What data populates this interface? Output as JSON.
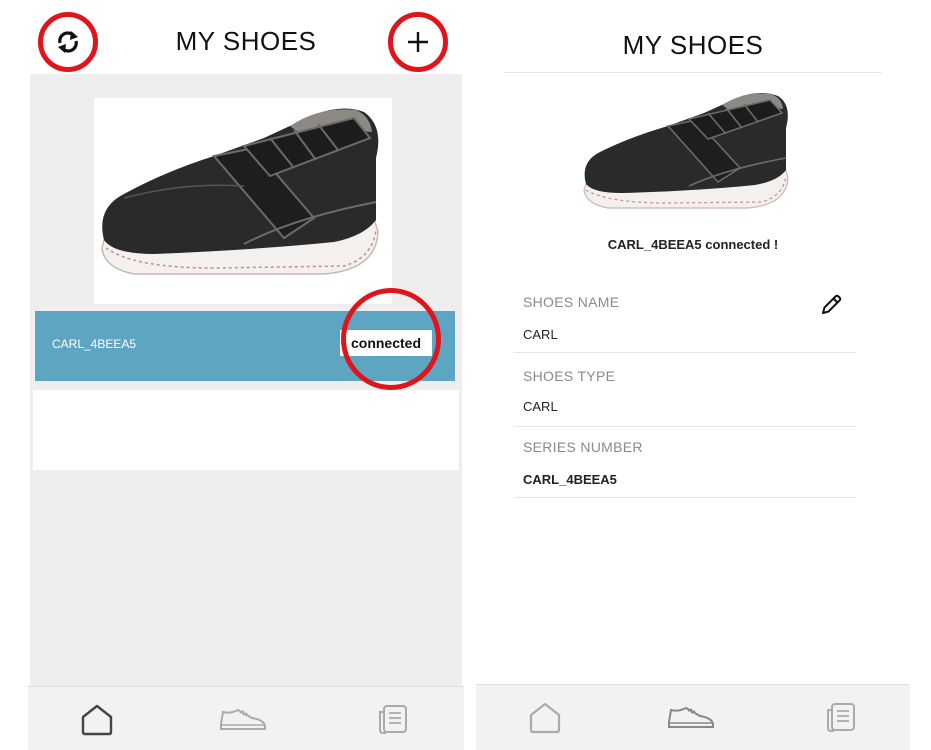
{
  "left": {
    "title": "MY SHOES",
    "device": {
      "name": "CARL_4BEEA5",
      "status": "connected"
    }
  },
  "right": {
    "title": "MY SHOES",
    "connection_message": "CARL_4BEEA5  connected !",
    "fields": [
      {
        "label": "SHOES NAME",
        "value": "CARL"
      },
      {
        "label": "SHOES TYPE",
        "value": "CARL"
      },
      {
        "label": "SERIES NUMBER",
        "value": "CARL_4BEEA5"
      }
    ]
  },
  "tabs": [
    {
      "icon": "home-icon"
    },
    {
      "icon": "shoe-icon"
    },
    {
      "icon": "document-icon"
    }
  ],
  "colors": {
    "highlight_ring": "#e0141a",
    "device_row": "#5ea5c2",
    "list_background": "#eeeeee"
  }
}
